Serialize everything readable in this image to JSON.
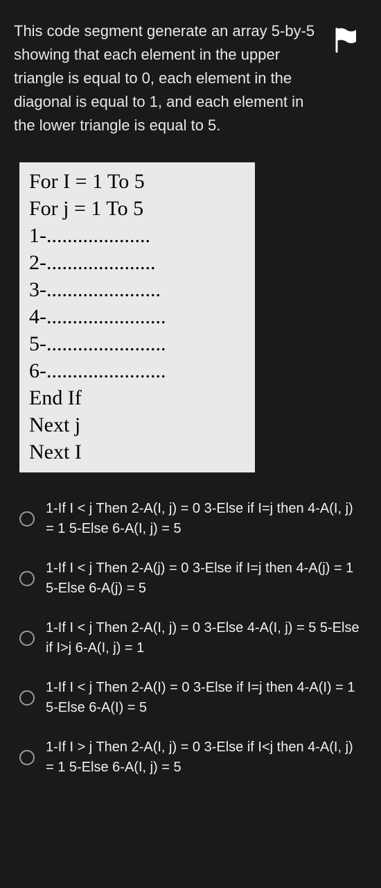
{
  "question": "This code segment generate an array 5-by-5 showing that each element in the upper triangle is equal to 0, each element in the diagonal is equal to 1, and each element in the lower triangle is equal to 5.",
  "code_lines": [
    "For I = 1 To 5",
    "For j = 1 To 5",
    "1-....................",
    "2-.....................",
    "3-......................",
    "4-.......................",
    "5-.......................",
    "6-.......................",
    "End If",
    "Next j",
    "Next I"
  ],
  "options": [
    "1-If I < j Then 2-A(I, j) = 0 3-Else if I=j then 4-A(I, j) = 1 5-Else 6-A(I, j) = 5",
    "1-If I < j Then 2-A(j) = 0 3-Else if I=j then 4-A(j) = 1 5-Else 6-A(j) = 5",
    "1-If I < j Then 2-A(I, j) = 0 3-Else 4-A(I, j) = 5 5-Else if I>j 6-A(I, j) = 1",
    "1-If I < j Then 2-A(I) = 0 3-Else if I=j then 4-A(I) = 1 5-Else 6-A(I) = 5",
    "1-If I > j Then 2-A(I, j) = 0 3-Else if I<j then 4-A(I, j) = 1 5-Else 6-A(I, j) = 5"
  ]
}
